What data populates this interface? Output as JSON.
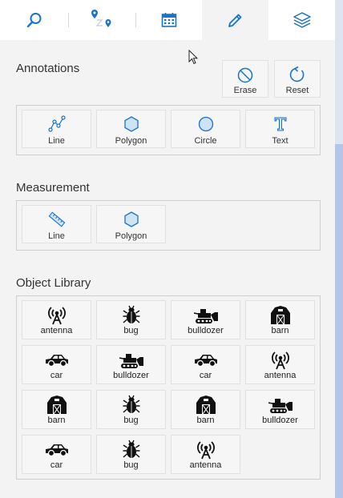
{
  "tabs": [
    {
      "name": "search",
      "icon": "search-icon"
    },
    {
      "name": "route",
      "icon": "route-icon"
    },
    {
      "name": "calendar",
      "icon": "calendar-icon"
    },
    {
      "name": "draw",
      "icon": "pencil-icon",
      "active": true
    },
    {
      "name": "layers",
      "icon": "layers-icon"
    }
  ],
  "annotations": {
    "title": "Annotations",
    "erase_label": "Erase",
    "reset_label": "Reset",
    "tools": [
      {
        "label": "Line",
        "icon": "polyline-icon"
      },
      {
        "label": "Polygon",
        "icon": "hexagon-icon"
      },
      {
        "label": "Circle",
        "icon": "circle-icon"
      },
      {
        "label": "Text",
        "icon": "text-icon"
      }
    ]
  },
  "measurement": {
    "title": "Measurement",
    "tools": [
      {
        "label": "Line",
        "icon": "ruler-icon"
      },
      {
        "label": "Polygon",
        "icon": "hexagon-icon"
      }
    ]
  },
  "object_library": {
    "title": "Object Library",
    "items": [
      {
        "label": "antenna",
        "icon": "antenna-icon"
      },
      {
        "label": "bug",
        "icon": "bug-icon"
      },
      {
        "label": "bulldozer",
        "icon": "bulldozer-icon"
      },
      {
        "label": "barn",
        "icon": "barn-icon"
      },
      {
        "label": "car",
        "icon": "car-icon"
      },
      {
        "label": "bulldozer",
        "icon": "bulldozer-icon"
      },
      {
        "label": "car",
        "icon": "car-icon"
      },
      {
        "label": "antenna",
        "icon": "antenna-icon"
      },
      {
        "label": "barn",
        "icon": "barn-icon"
      },
      {
        "label": "bug",
        "icon": "bug-icon"
      },
      {
        "label": "barn",
        "icon": "barn-icon"
      },
      {
        "label": "bulldozer",
        "icon": "bulldozer-icon"
      },
      {
        "label": "car",
        "icon": "car-icon"
      },
      {
        "label": "bug",
        "icon": "bug-icon"
      },
      {
        "label": "antenna",
        "icon": "antenna-icon"
      }
    ]
  },
  "colors": {
    "accent": "#1a73c8",
    "icon_dark": "#111111",
    "background": "#f3f3f3"
  }
}
